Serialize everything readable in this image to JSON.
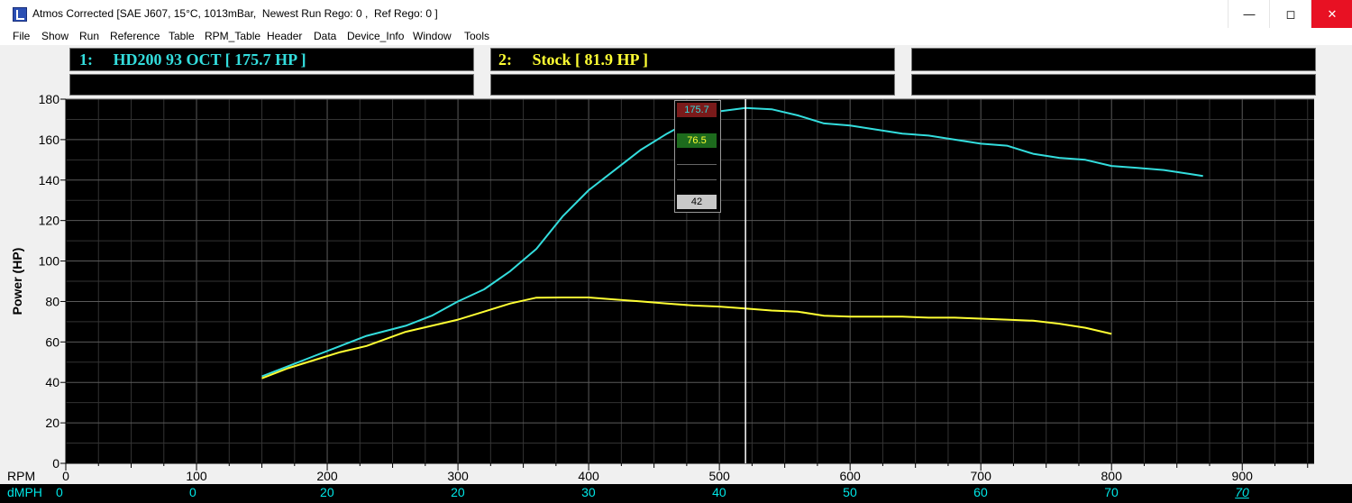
{
  "window": {
    "title": "Atmos Corrected [SAE J607, 15°C, 1013mBar,  Newest Run Rego: 0 ,  Ref Rego: 0 ]",
    "min_glyph": "—",
    "max_glyph": "◻",
    "close_glyph": "✕"
  },
  "menu": [
    "File",
    "Show",
    "Run",
    "Reference",
    "Table",
    "RPM_Table",
    "Header",
    "Data",
    "Device_Info",
    "Window",
    "Tools"
  ],
  "runs": [
    {
      "label": "1:     HD200 93 OCT [ 175.7 HP ]",
      "color": "#33dddd"
    },
    {
      "label": "2:     Stock [ 81.9 HP ]",
      "color": "#ffff33"
    }
  ],
  "cursor": {
    "rpm": 520,
    "values": [
      "175.7",
      "76.5",
      "",
      "42"
    ],
    "colors": [
      "#7a1a1a",
      "#1d6b1d",
      "#000000",
      "#c8c8c8"
    ]
  },
  "speed_axis": {
    "label": "dMPH",
    "ticks": [
      {
        "rpm": 0,
        "value": "0"
      },
      {
        "rpm": 100,
        "value": "0"
      },
      {
        "rpm": 200,
        "value": "20"
      },
      {
        "rpm": 300,
        "value": "20"
      },
      {
        "rpm": 400,
        "value": "30"
      },
      {
        "rpm": 500,
        "value": "40"
      },
      {
        "rpm": 600,
        "value": "50"
      },
      {
        "rpm": 700,
        "value": "60"
      },
      {
        "rpm": 800,
        "value": "70"
      },
      {
        "rpm": 900,
        "value": "70"
      }
    ]
  },
  "chart_data": {
    "type": "line",
    "xlabel": "RPM",
    "ylabel": "Power (HP)",
    "xlim": [
      0,
      955
    ],
    "ylim": [
      0,
      180
    ],
    "xticks": [
      0,
      100,
      200,
      300,
      400,
      500,
      600,
      700,
      800,
      900
    ],
    "yticks": [
      0,
      20,
      40,
      60,
      80,
      100,
      120,
      140,
      160,
      180
    ],
    "grid": true,
    "background": "#000000",
    "series": [
      {
        "name": "HD200 93 OCT",
        "color": "#33dddd",
        "x": [
          150,
          170,
          190,
          210,
          230,
          260,
          280,
          300,
          320,
          340,
          360,
          380,
          400,
          420,
          440,
          460,
          480,
          500,
          520,
          540,
          560,
          580,
          600,
          620,
          640,
          660,
          680,
          700,
          720,
          740,
          760,
          780,
          800,
          820,
          840,
          860,
          870
        ],
        "values": [
          43,
          48,
          53,
          58,
          63,
          68,
          73,
          80,
          86,
          95,
          106,
          122,
          135,
          145,
          155,
          163,
          170,
          174,
          175.7,
          175,
          172,
          168,
          167,
          165,
          163,
          162,
          160,
          158,
          157,
          153,
          151,
          150,
          147,
          146,
          145,
          143,
          142
        ]
      },
      {
        "name": "Stock",
        "color": "#ffff33",
        "x": [
          150,
          170,
          190,
          210,
          230,
          260,
          280,
          300,
          320,
          340,
          360,
          380,
          400,
          420,
          440,
          460,
          480,
          500,
          520,
          540,
          560,
          580,
          600,
          620,
          640,
          660,
          680,
          700,
          720,
          740,
          760,
          780,
          800
        ],
        "values": [
          42,
          47,
          51,
          55,
          58,
          65,
          68,
          71,
          75,
          79,
          81.9,
          82,
          82,
          81,
          80,
          79,
          78,
          77.5,
          76.5,
          75.5,
          75,
          73,
          72.5,
          72.5,
          72.5,
          72,
          72,
          71.5,
          71,
          70.5,
          69,
          67,
          64
        ]
      }
    ]
  }
}
